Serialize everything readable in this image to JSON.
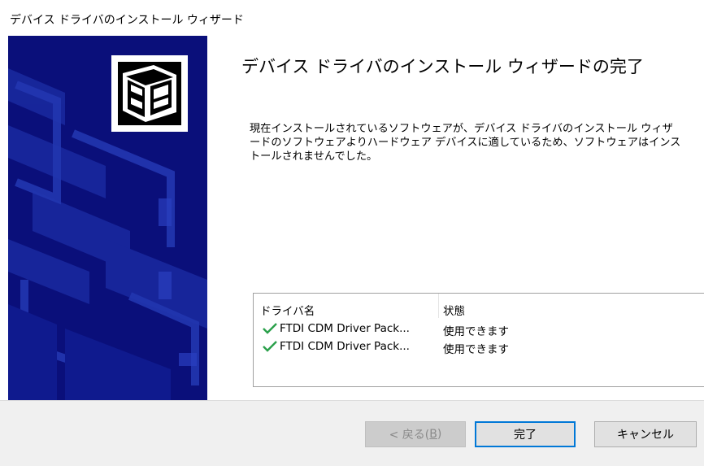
{
  "window": {
    "title": "デバイス ドライバのインストール ウィザード"
  },
  "main": {
    "heading": "デバイス ドライバのインストール ウィザードの完了",
    "description_lines": [
      "現在インストールされているソフトウェアが、デバイス ドライバのインストール ウィザ",
      "ードのソフトウェアよりハードウェア デバイスに適しているため、ソフトウェアはインス",
      "トールされませんでした。"
    ]
  },
  "driver_list": {
    "columns": [
      "ドライバ名",
      "状態"
    ],
    "rows": [
      {
        "name": "FTDI CDM Driver Pack...",
        "status": "使用できます",
        "icon": "check-icon"
      },
      {
        "name": "FTDI CDM Driver Pack...",
        "status": "使用できます",
        "icon": "check-icon"
      }
    ]
  },
  "buttons": {
    "back": {
      "label": "< 戻る(",
      "accel": "B",
      "label_end": ")",
      "enabled": false
    },
    "finish": {
      "label": "完了"
    },
    "cancel": {
      "label": "キャンセル"
    }
  },
  "colors": {
    "side_panel": "#0a0f7a",
    "check": "#2aa04a",
    "focus_border": "#0078d7"
  },
  "icons": {
    "wizard": "hardware-wizard-icon"
  }
}
